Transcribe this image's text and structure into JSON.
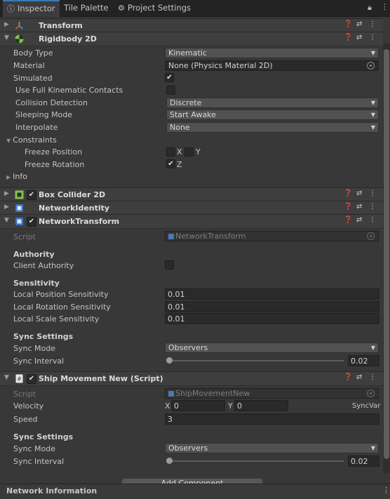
{
  "tabs": [
    {
      "label": "Inspector",
      "icon": "info-icon"
    },
    {
      "label": "Tile Palette"
    },
    {
      "label": "Project Settings",
      "icon": "gear-icon"
    }
  ],
  "components": {
    "transform": {
      "title": "Transform"
    },
    "rigidbody": {
      "title": "Rigidbody 2D",
      "body_type": {
        "label": "Body Type",
        "value": "Kinematic"
      },
      "material": {
        "label": "Material",
        "value": "None (Physics Material 2D)"
      },
      "simulated": {
        "label": "Simulated",
        "checked": true
      },
      "full_kinematic": {
        "label": "Use Full Kinematic Contacts",
        "checked": false
      },
      "collision_detection": {
        "label": "Collision Detection",
        "value": "Discrete"
      },
      "sleeping_mode": {
        "label": "Sleeping Mode",
        "value": "Start Awake"
      },
      "interpolate": {
        "label": "Interpolate",
        "value": "None"
      },
      "constraints": {
        "label": "Constraints",
        "freeze_position": {
          "label": "Freeze Position",
          "x": "X",
          "y": "Y"
        },
        "freeze_rotation": {
          "label": "Freeze Rotation",
          "z": "Z"
        }
      },
      "info": {
        "label": "Info"
      }
    },
    "box_collider": {
      "title": "Box Collider 2D"
    },
    "network_identity": {
      "title": "NetworkIdentity"
    },
    "network_transform": {
      "title": "NetworkTransform",
      "script": {
        "label": "Script",
        "value": "NetworkTransform"
      },
      "authority_header": "Authority",
      "client_authority": {
        "label": "Client Authority",
        "checked": false
      },
      "sensitivity_header": "Sensitivity",
      "local_position": {
        "label": "Local Position Sensitivity",
        "value": "0.01"
      },
      "local_rotation": {
        "label": "Local Rotation Sensitivity",
        "value": "0.01"
      },
      "local_scale": {
        "label": "Local Scale Sensitivity",
        "value": "0.01"
      },
      "sync_header": "Sync Settings",
      "sync_mode": {
        "label": "Sync Mode",
        "value": "Observers"
      },
      "sync_interval": {
        "label": "Sync Interval",
        "value": "0.02",
        "slider_fraction": 0
      }
    },
    "ship_movement": {
      "title": "Ship Movement New (Script)",
      "script": {
        "label": "Script",
        "value": "ShipMovementNew"
      },
      "velocity": {
        "label": "Velocity",
        "x_label": "X",
        "x": "0",
        "y_label": "Y",
        "y": "0",
        "tag": "SyncVar"
      },
      "speed": {
        "label": "Speed",
        "value": "3"
      },
      "sync_header": "Sync Settings",
      "sync_mode": {
        "label": "Sync Mode",
        "value": "Observers"
      },
      "sync_interval": {
        "label": "Sync Interval",
        "value": "0.02",
        "slider_fraction": 0
      }
    }
  },
  "add_component": {
    "label": "Add Component"
  },
  "footer": {
    "label": "Network Information"
  },
  "colors": {
    "accent": "#3a79bb",
    "background": "#383838",
    "header": "#3e3e3e"
  }
}
